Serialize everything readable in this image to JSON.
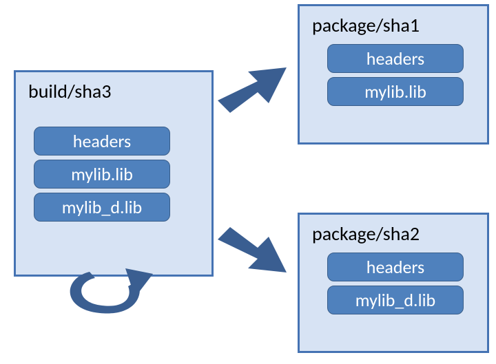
{
  "build": {
    "title": "build/sha3",
    "items": [
      "headers",
      "mylib.lib",
      "mylib_d.lib"
    ]
  },
  "package1": {
    "title": "package/sha1",
    "items": [
      "headers",
      "mylib.lib"
    ]
  },
  "package2": {
    "title": "package/sha2",
    "items": [
      "headers",
      "mylib_d.lib"
    ]
  }
}
